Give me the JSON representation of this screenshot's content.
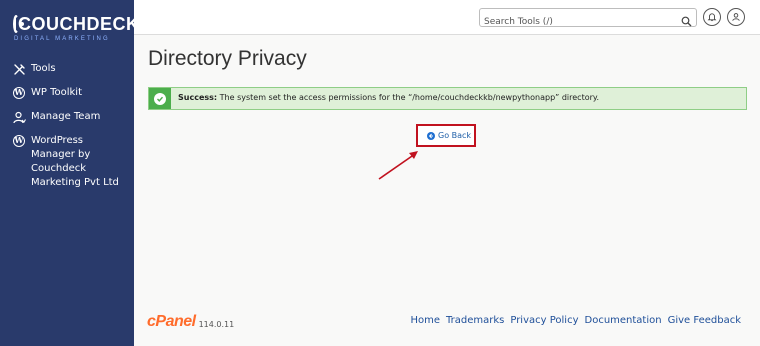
{
  "brand": {
    "name": "COUCHDECK",
    "tagline": "DIGITAL MARKETING"
  },
  "sidebar": {
    "items": [
      {
        "label": "Tools",
        "icon": "tools-icon"
      },
      {
        "label": "WP Toolkit",
        "icon": "wordpress-icon"
      },
      {
        "label": "Manage Team",
        "icon": "manage-team-icon"
      },
      {
        "label": "WordPress Manager by Couchdeck Marketing Pvt Ltd",
        "icon": "wordpress-icon"
      }
    ]
  },
  "topbar": {
    "search_placeholder": "Search Tools (/)",
    "icons": [
      "search-icon",
      "bell-icon",
      "user-icon"
    ]
  },
  "page": {
    "title": "Directory Privacy",
    "alert": {
      "prefix": "Success:",
      "message": "The system set the access permissions for the “/home/couchdeckkb/newpythonapp” directory."
    },
    "go_back_label": "Go Back"
  },
  "footer": {
    "logo": "cPanel",
    "version": "114.0.11",
    "links": [
      "Home",
      "Trademarks",
      "Privacy Policy",
      "Documentation",
      "Give Feedback"
    ]
  },
  "colors": {
    "sidebar": "#293a6b",
    "success": "#4cae4c",
    "highlight": "#c1121f",
    "link": "#1f4f99",
    "cpanel": "#ff6c2c"
  }
}
